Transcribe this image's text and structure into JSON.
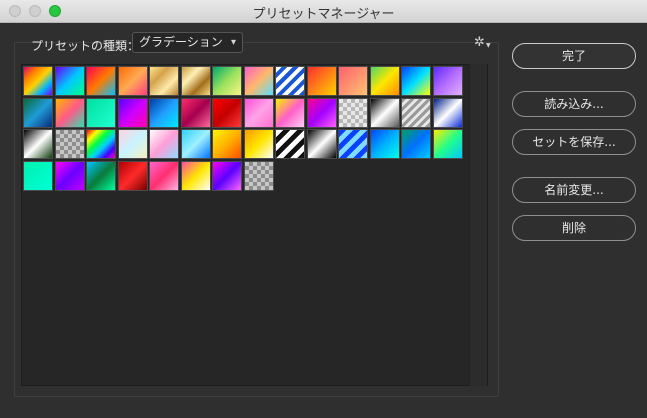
{
  "window": {
    "title": "プリセットマネージャー"
  },
  "preset_type": {
    "label": "プリセットの種類：",
    "value": "グラデーション"
  },
  "buttons": {
    "done": "完了",
    "load": "読み込み...",
    "save_set": "セットを保存...",
    "rename": "名前変更...",
    "delete": "削除"
  },
  "swatches": [
    {
      "bg": "linear-gradient(135deg,#e0006e,#ff7a00,#ffd200,#00b7ff,#7a00ff)"
    },
    {
      "bg": "linear-gradient(135deg,#6a00ff,#00c8ff,#00ff88)"
    },
    {
      "bg": "linear-gradient(135deg,#ff0055,#ff7a00,#00c0ff)"
    },
    {
      "bg": "linear-gradient(135deg,#ff6a00,#ffaa55,#ff3d7f)"
    },
    {
      "bg": "linear-gradient(135deg,#ffe68a,#d3a24a,#ffe9a9,#b58030)"
    },
    {
      "bg": "linear-gradient(135deg,#c59b3a,#fff0b5,#a36e1a,#f7dc88)"
    },
    {
      "bg": "linear-gradient(135deg,#00a96b,#9be15d,#f9f586)"
    },
    {
      "bg": "linear-gradient(135deg,#ff5ec4,#ffb86c,#57e0ff)"
    },
    {
      "bg": "repeating-linear-gradient(135deg,#ffffff 0 4px,#1a57d6 4px 8px)"
    },
    {
      "bg": "linear-gradient(135deg,#ff2d2d,#ffd300)"
    },
    {
      "bg": "linear-gradient(135deg,#ff5f6d,#ffc371)"
    },
    {
      "bg": "linear-gradient(135deg,#4cd964,#ffe600,#ff8a00)"
    },
    {
      "bg": "linear-gradient(135deg,#0040ff,#00e0ff,#ffff00)"
    },
    {
      "bg": "linear-gradient(135deg,#5b2aff,#b36cff,#e0b2ff)"
    },
    {
      "bg": "linear-gradient(135deg,#0a6b3a,#1f9bd6,#0b2a7a)"
    },
    {
      "bg": "linear-gradient(135deg,#ffb400,#ff5a88,#2fe0b0)"
    },
    {
      "bg": "linear-gradient(135deg,#00e0a0,#20ffd0)"
    },
    {
      "bg": "linear-gradient(135deg,#5a00ff,#d000ff,#ff00a8)"
    },
    {
      "bg": "linear-gradient(135deg,#003da5,#21a0ff,#00e9ff)"
    },
    {
      "bg": "linear-gradient(135deg,#ff2a6d,#a3004d,#ff6a9a)"
    },
    {
      "bg": "linear-gradient(135deg,#ff0000,#c40000,#ff3b3b)"
    },
    {
      "bg": "linear-gradient(135deg,#ff4fd8,#ffa3e8,#ff6fd0)"
    },
    {
      "bg": "linear-gradient(135deg,#fff200,#ff5ec8,#ffd0f4)"
    },
    {
      "bg": "linear-gradient(135deg,#ff0090,#a200ff,#ff61ff)"
    },
    {
      "bg": "repeating-conic-gradient(#b7b7b7 0 25%,#e8e8e8 0 50%) 0 0/8px 8px, linear-gradient(135deg,#ff4fd8,#7a6cff)"
    },
    {
      "bg": "linear-gradient(135deg,#000000,#ffffff,#555555)"
    },
    {
      "bg": "repeating-linear-gradient(135deg,#9a9a9a 0 3px,#e8e8e8 3px 6px)"
    },
    {
      "bg": "linear-gradient(135deg,#001f8a,#ffffff,#0a2bd6)"
    },
    {
      "bg": "linear-gradient(135deg,#000000,#ffffff,#0f3d0f)"
    },
    {
      "bg": "repeating-conic-gradient(#8d8d8d 0 25%,#c7c7c7 0 50%) 0 0/8px 8px"
    },
    {
      "bg": "linear-gradient(135deg,#ff0000,#ffff00,#00ff40,#00d0ff,#4000ff,#ff00c0)"
    },
    {
      "bg": "linear-gradient(135deg,#ffd2e0,#c8f3ff,#f7f0c0)"
    },
    {
      "bg": "linear-gradient(135deg,#ffffff,#ff9dd6,#8fdcff)"
    },
    {
      "bg": "linear-gradient(135deg,#2fd0ff,#9ff0ff,#0074ff)"
    },
    {
      "bg": "linear-gradient(135deg,#fff400,#ffb000,#ff4d00)"
    },
    {
      "bg": "linear-gradient(135deg,#ff9a00,#ffe600,#ffffff)"
    },
    {
      "bg": "repeating-linear-gradient(135deg,#ffffff 0 5px,#111111 5px 10px)"
    },
    {
      "bg": "linear-gradient(135deg,#000000,#ffffff,#000000)"
    },
    {
      "bg": "repeating-linear-gradient(135deg,#0a40ff 0 5px,#7fdcff 5px 10px)"
    },
    {
      "bg": "linear-gradient(135deg,#0047ff,#00b0ff,#00ffea)"
    },
    {
      "bg": "linear-gradient(135deg,#00a060,#0070ff,#00d0ff)"
    },
    {
      "bg": "linear-gradient(135deg,#ffec00,#23ff8b,#00c8ff)"
    },
    {
      "bg": "linear-gradient(135deg,#00f0b0,#00ffd5)"
    },
    {
      "bg": "linear-gradient(135deg,#ff00ff,#6a00ff,#c300ff)"
    },
    {
      "bg": "linear-gradient(135deg,#00c4ff,#0a7a3a,#00ffa0)"
    },
    {
      "bg": "linear-gradient(135deg,#b00000,#ff2a2a,#7a0000)"
    },
    {
      "bg": "linear-gradient(135deg,#ff66cc,#ff2e6e,#ffb3e6)"
    },
    {
      "bg": "linear-gradient(135deg,#ff4f9a,#ffe600,#ffffff)"
    },
    {
      "bg": "linear-gradient(135deg,#ff00f0,#5a00ff,#ff66ff)"
    },
    {
      "bg": "repeating-conic-gradient(#8d8d8d 0 25%,#c7c7c7 0 50%) 0 0/8px 8px, linear-gradient(135deg,#ff66ff,#ff00cc)"
    }
  ]
}
